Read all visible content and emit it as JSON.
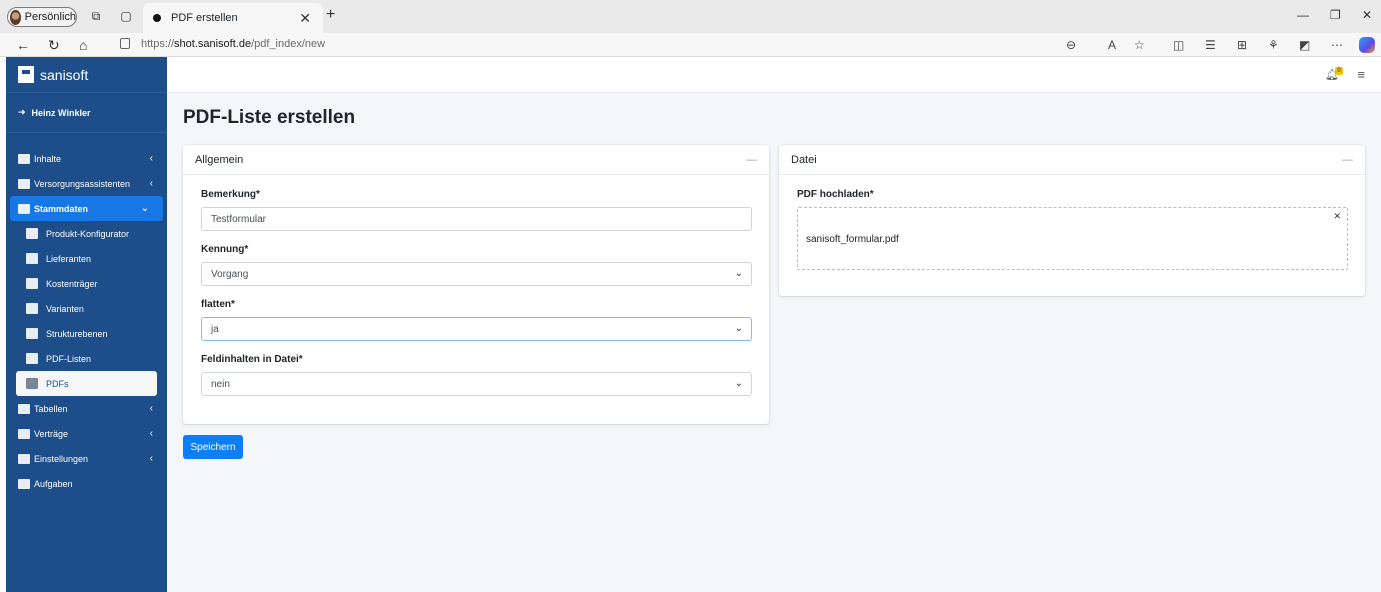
{
  "browser": {
    "profile_label": "Persönlich",
    "tab_title": "PDF erstellen",
    "url_prefix": "https://",
    "url_host": "shot.sanisoft.de",
    "url_path": "/pdf_index/new"
  },
  "sidebar": {
    "brand": "sanisoft",
    "user": "Heinz Winkler",
    "items": [
      {
        "label": "Inhalte"
      },
      {
        "label": "Versorgungsassistenten"
      },
      {
        "label": "Stammdaten"
      },
      {
        "label": "Produkt-Konfigurator"
      },
      {
        "label": "Lieferanten"
      },
      {
        "label": "Kostenträger"
      },
      {
        "label": "Varianten"
      },
      {
        "label": "Strukturebenen"
      },
      {
        "label": "PDF-Listen"
      },
      {
        "label": "PDFs"
      },
      {
        "label": "Tabellen"
      },
      {
        "label": "Verträge"
      },
      {
        "label": "Einstellungen"
      },
      {
        "label": "Aufgaben"
      }
    ]
  },
  "topbar": {
    "notification_count": "0"
  },
  "page": {
    "title": "PDF-Liste erstellen",
    "save_label": "Speichern"
  },
  "card_general": {
    "title": "Allgemein",
    "fields": [
      {
        "label": "Bemerkung*",
        "value": "Testformular"
      },
      {
        "label": "Kennung*",
        "value": "Vorgang"
      },
      {
        "label": "flatten*",
        "value": "ja"
      },
      {
        "label": "Feldinhalten in Datei*",
        "value": "nein"
      }
    ]
  },
  "card_file": {
    "title": "Datei",
    "upload_label": "PDF hochladen*",
    "file_name": "sanisoft_formular.pdf"
  },
  "colors": {
    "sidebar": "#1d4e8a",
    "primary": "#0d7ef4",
    "active_nav": "#1677e5"
  }
}
